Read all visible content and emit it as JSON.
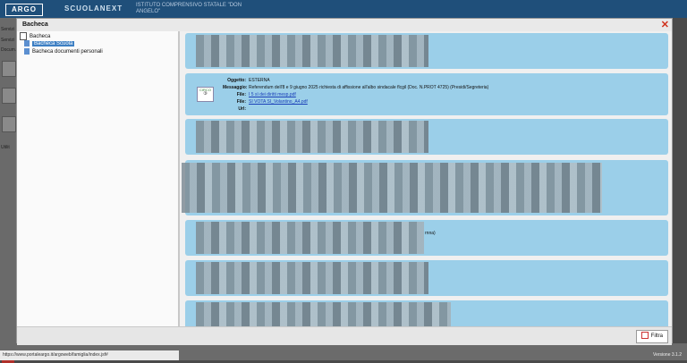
{
  "app": {
    "logo": "ARGO",
    "name": "SCUOLANEXT",
    "school": "ISTITUTO COMPRENSIVO STATALE \"DON ANGELO\""
  },
  "background": {
    "side_labels": [
      "Servizi",
      "Servizi",
      "Docum."
    ],
    "bottom_label": "Utilit",
    "status_url": "https://www.portaleargo.it/argoweb/famiglia/index.jsf#",
    "version": "Versione 3.1.2"
  },
  "dialog": {
    "title": "Bacheca",
    "tree": {
      "root": "Bacheca",
      "items": [
        "Bacheca Scuola",
        "Bacheca documenti personali"
      ]
    },
    "message": {
      "icon_text": "CIRCO",
      "oggetto_label": "Oggetto:",
      "oggetto": "ESTERNA",
      "messaggio_label": "Messaggio:",
      "messaggio": "Referendum dell'8 e 9 giugno 2025 richiesta di affissione all'albo sindacale flcgil (Doc. N.PROT 4725) (Presidi/Segreteria)",
      "file_label": "File:",
      "file1": "I 5 sì dei diritti mesp.pdf",
      "file2": "SI VOTA SI_Volantino_A4.pdf",
      "url_label": "Url:"
    },
    "fragment": "rnna)",
    "filter_button": "Filtra"
  }
}
